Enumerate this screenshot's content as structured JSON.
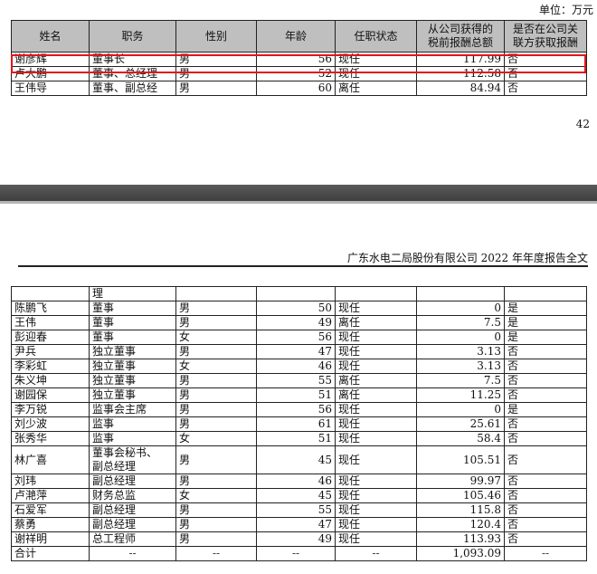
{
  "unit_label": "单位：万元",
  "page_number": "42",
  "running_header": "广东水电二局股份有限公司 2022 年年度报告全文",
  "table1": {
    "headers": [
      "姓名",
      "职务",
      "性别",
      "年龄",
      "任职状态",
      "从公司获得的税前报酬总额",
      "是否在公司关联方获取报酬"
    ],
    "header_lines": {
      "pay": [
        "从公司获得的",
        "税前报酬总额"
      ],
      "related": [
        "是否在公司关",
        "联方获取报酬"
      ]
    },
    "rows": [
      {
        "name": "谢彦辉",
        "title": "董事长",
        "gender": "男",
        "age": "56",
        "status": "现任",
        "pay": "117.99",
        "related": "否"
      },
      {
        "name": "卢大鹏",
        "title": "董事、总经理",
        "gender": "男",
        "age": "52",
        "status": "现任",
        "pay": "112.58",
        "related": "否"
      },
      {
        "name": "王伟导",
        "title": "董事、副总经",
        "gender": "男",
        "age": "60",
        "status": "离任",
        "pay": "84.94",
        "related": "否"
      }
    ]
  },
  "table2": {
    "continuation_text": "理",
    "rows": [
      {
        "name": "陈鹏飞",
        "title": "董事",
        "gender": "男",
        "age": "50",
        "status": "现任",
        "pay": "0",
        "related": "是"
      },
      {
        "name": "王伟",
        "title": "董事",
        "gender": "男",
        "age": "49",
        "status": "离任",
        "pay": "7.5",
        "related": "是"
      },
      {
        "name": "彭迎春",
        "title": "董事",
        "gender": "女",
        "age": "56",
        "status": "现任",
        "pay": "0",
        "related": "是"
      },
      {
        "name": "尹兵",
        "title": "独立董事",
        "gender": "男",
        "age": "47",
        "status": "现任",
        "pay": "3.13",
        "related": "否"
      },
      {
        "name": "李彩虹",
        "title": "独立董事",
        "gender": "女",
        "age": "46",
        "status": "现任",
        "pay": "3.13",
        "related": "否"
      },
      {
        "name": "朱义坤",
        "title": "独立董事",
        "gender": "男",
        "age": "55",
        "status": "离任",
        "pay": "7.5",
        "related": "否"
      },
      {
        "name": "谢园保",
        "title": "独立董事",
        "gender": "男",
        "age": "51",
        "status": "离任",
        "pay": "11.25",
        "related": "否"
      },
      {
        "name": "李万锐",
        "title": "监事会主席",
        "gender": "男",
        "age": "56",
        "status": "现任",
        "pay": "0",
        "related": "是"
      },
      {
        "name": "刘少波",
        "title": "监事",
        "gender": "男",
        "age": "61",
        "status": "现任",
        "pay": "25.61",
        "related": "否"
      },
      {
        "name": "张秀华",
        "title": "监事",
        "gender": "女",
        "age": "51",
        "status": "现任",
        "pay": "58.4",
        "related": "否"
      },
      {
        "name": "林广喜",
        "title": "董事会秘书、副总经理",
        "title_lines": [
          "董事会秘书、",
          "副总经理"
        ],
        "gender": "男",
        "age": "45",
        "status": "现任",
        "pay": "105.51",
        "related": "否"
      },
      {
        "name": "刘玮",
        "title": "副总经理",
        "gender": "男",
        "age": "46",
        "status": "现任",
        "pay": "99.97",
        "related": "否"
      },
      {
        "name": "卢滟萍",
        "title": "财务总监",
        "gender": "女",
        "age": "45",
        "status": "现任",
        "pay": "105.46",
        "related": "否"
      },
      {
        "name": "石爱军",
        "title": "副总经理",
        "gender": "男",
        "age": "55",
        "status": "现任",
        "pay": "115.8",
        "related": "否"
      },
      {
        "name": "蔡勇",
        "title": "副总经理",
        "gender": "男",
        "age": "47",
        "status": "现任",
        "pay": "120.4",
        "related": "否"
      },
      {
        "name": "谢祥明",
        "title": "总工程师",
        "gender": "男",
        "age": "49",
        "status": "现任",
        "pay": "113.93",
        "related": "否"
      }
    ],
    "total": {
      "label": "合计",
      "dash": "--",
      "pay": "1,093.09"
    }
  },
  "colors": {
    "header_bg": "#bfbfbf",
    "highlight_border": "#e0161b",
    "page_gap": "#4a4a4a"
  }
}
